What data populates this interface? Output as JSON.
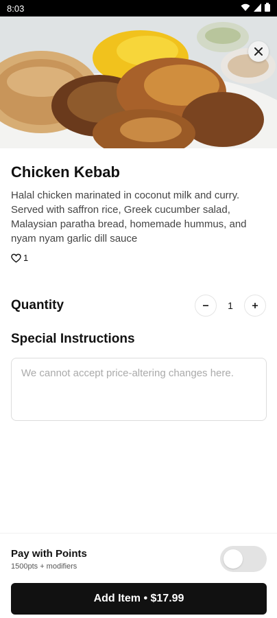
{
  "status_bar": {
    "time": "8:03",
    "icons": [
      "wifi-icon",
      "signal-icon",
      "battery-icon"
    ]
  },
  "hero": {
    "image": "food-photo",
    "close_icon": "close-icon"
  },
  "item": {
    "name": "Chicken Kebab",
    "description": "Halal chicken marinated in coconut milk and curry. Served with saffron rice, Greek cucumber salad, Malaysian paratha bread, homemade hummus, and nyam nyam garlic dill sauce",
    "likes": "1",
    "like_icon": "heart-icon"
  },
  "quantity": {
    "label": "Quantity",
    "value": "1",
    "decrement_icon": "minus-icon",
    "increment_icon": "plus-icon"
  },
  "instructions": {
    "label": "Special Instructions",
    "placeholder": "We cannot accept price-altering changes here.",
    "value": ""
  },
  "points": {
    "title": "Pay with Points",
    "subtitle": "1500pts + modifiers",
    "toggle_on": false
  },
  "add_button": {
    "label": "Add Item • $17.99"
  },
  "colors": {
    "primary": "#111111",
    "toggle_track": "#e3e3e3"
  }
}
